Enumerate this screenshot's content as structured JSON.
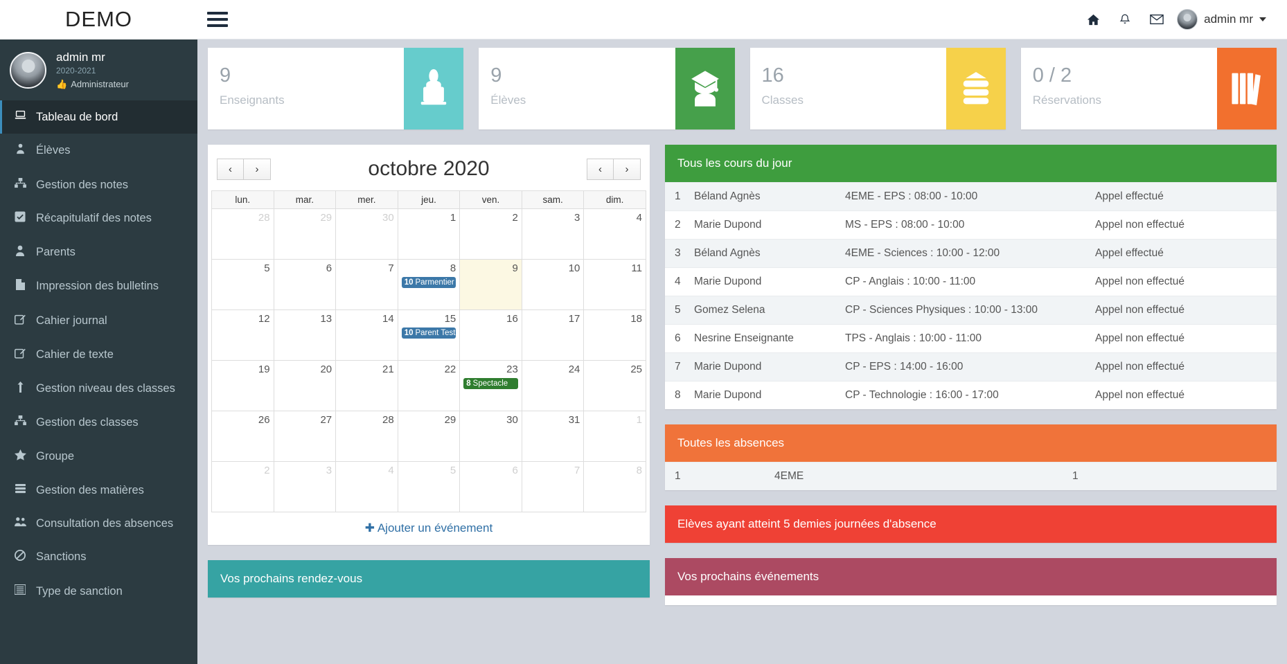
{
  "brand": {
    "title": "DEMO"
  },
  "topbar": {
    "icons": [
      {
        "name": "home-icon",
        "glyph": "⌂"
      },
      {
        "name": "bell-icon",
        "glyph": "△"
      },
      {
        "name": "envelope-icon",
        "glyph": "✉"
      }
    ],
    "user": "admin mr"
  },
  "sidebar": {
    "user": {
      "name": "admin mr",
      "year": "2020-2021",
      "role": "Administrateur",
      "role_icon": "thumbs-up-icon"
    },
    "items": [
      {
        "label": "Tableau de bord",
        "icon": "laptop-icon",
        "glyph": "⬜",
        "active": true
      },
      {
        "label": "Élèves",
        "icon": "user-tie-icon",
        "glyph": "♟",
        "active": false
      },
      {
        "label": "Gestion des notes",
        "icon": "sitemap-icon",
        "glyph": "⚘",
        "active": false
      },
      {
        "label": "Récapitulatif des notes",
        "icon": "check-square-icon",
        "glyph": "☑",
        "active": false
      },
      {
        "label": "Parents",
        "icon": "user-icon",
        "glyph": "♟",
        "active": false
      },
      {
        "label": "Impression des bulletins",
        "icon": "file-icon",
        "glyph": "▯",
        "active": false
      },
      {
        "label": "Cahier journal",
        "icon": "edit-icon",
        "glyph": "✎",
        "active": false
      },
      {
        "label": "Cahier de texte",
        "icon": "edit-icon",
        "glyph": "✎",
        "active": false
      },
      {
        "label": "Gestion niveau des classes",
        "icon": "level-up-icon",
        "glyph": "⤴",
        "active": false
      },
      {
        "label": "Gestion des classes",
        "icon": "sitemap-icon",
        "glyph": "⚙",
        "active": false
      },
      {
        "label": "Groupe",
        "icon": "star-icon",
        "glyph": "★",
        "active": false
      },
      {
        "label": "Gestion des matières",
        "icon": "books-icon",
        "glyph": "☰",
        "active": false
      },
      {
        "label": "Consultation des absences",
        "icon": "users-icon",
        "glyph": "♟",
        "active": false
      },
      {
        "label": "Sanctions",
        "icon": "ban-icon",
        "glyph": "⊘",
        "active": false
      },
      {
        "label": "Type de sanction",
        "icon": "list-icon",
        "glyph": "☰",
        "active": false
      }
    ]
  },
  "stats": [
    {
      "value": "9",
      "label": "Enseignants",
      "color": "#66cccc",
      "icon": "teacher-icon"
    },
    {
      "value": "9",
      "label": "Élèves",
      "color": "#46a04b",
      "icon": "graduate-icon"
    },
    {
      "value": "16",
      "label": "Classes",
      "color": "#f6d14a",
      "icon": "books-stack-icon"
    },
    {
      "value": "0 / 2",
      "label": "Réservations",
      "color": "#f2702e",
      "icon": "library-icon"
    }
  ],
  "calendar": {
    "title": "octobre 2020",
    "nav": {
      "prev": "‹",
      "next": "›"
    },
    "weekdays": [
      "lun.",
      "mar.",
      "mer.",
      "jeu.",
      "ven.",
      "sam.",
      "dim."
    ],
    "add_event_label": "Ajouter un événement",
    "add_event_icon": "plus-icon",
    "weeks": [
      [
        {
          "d": "28",
          "other": true
        },
        {
          "d": "29",
          "other": true
        },
        {
          "d": "30",
          "other": true
        },
        {
          "d": "1"
        },
        {
          "d": "2"
        },
        {
          "d": "3"
        },
        {
          "d": "4"
        }
      ],
      [
        {
          "d": "5"
        },
        {
          "d": "6"
        },
        {
          "d": "7"
        },
        {
          "d": "8",
          "event": {
            "count": "10",
            "title": "Parmentier",
            "color": "blue"
          }
        },
        {
          "d": "9",
          "today": true
        },
        {
          "d": "10"
        },
        {
          "d": "11"
        }
      ],
      [
        {
          "d": "12"
        },
        {
          "d": "13"
        },
        {
          "d": "14"
        },
        {
          "d": "15",
          "event": {
            "count": "10",
            "title": "Parent Test",
            "color": "blue"
          }
        },
        {
          "d": "16"
        },
        {
          "d": "17"
        },
        {
          "d": "18"
        }
      ],
      [
        {
          "d": "19"
        },
        {
          "d": "20"
        },
        {
          "d": "21"
        },
        {
          "d": "22"
        },
        {
          "d": "23",
          "event": {
            "count": "8",
            "title": "Spectacle",
            "color": "green"
          }
        },
        {
          "d": "24"
        },
        {
          "d": "25"
        }
      ],
      [
        {
          "d": "26"
        },
        {
          "d": "27"
        },
        {
          "d": "28"
        },
        {
          "d": "29"
        },
        {
          "d": "30"
        },
        {
          "d": "31"
        },
        {
          "d": "1",
          "other": true
        }
      ],
      [
        {
          "d": "2",
          "other": true
        },
        {
          "d": "3",
          "other": true
        },
        {
          "d": "4",
          "other": true
        },
        {
          "d": "5",
          "other": true
        },
        {
          "d": "6",
          "other": true
        },
        {
          "d": "7",
          "other": true
        },
        {
          "d": "8",
          "other": true
        }
      ]
    ]
  },
  "appointments": {
    "title": "Vos prochains rendez-vous"
  },
  "courses": {
    "title": "Tous les cours du jour",
    "rows": [
      {
        "idx": "1",
        "teacher": "Béland Agnès",
        "course": "4EME - EPS : 08:00 - 10:00",
        "status": "Appel effectué",
        "status_type": "done"
      },
      {
        "idx": "2",
        "teacher": "Marie Dupond",
        "course": "MS - EPS : 08:00 - 10:00",
        "status": "Appel non effectué",
        "status_type": "pending"
      },
      {
        "idx": "3",
        "teacher": "Béland Agnès",
        "course": "4EME - Sciences : 10:00 - 12:00",
        "status": "Appel effectué",
        "status_type": "done"
      },
      {
        "idx": "4",
        "teacher": "Marie Dupond",
        "course": "CP - Anglais : 10:00 - 11:00",
        "status": "Appel non effectué",
        "status_type": "pending"
      },
      {
        "idx": "5",
        "teacher": "Gomez Selena",
        "course": "CP - Sciences Physiques : 10:00 - 13:00",
        "status": "Appel non effectué",
        "status_type": "pending"
      },
      {
        "idx": "6",
        "teacher": "Nesrine Enseignante",
        "course": "TPS - Anglais : 10:00 - 11:00",
        "status": "Appel non effectué",
        "status_type": "pending"
      },
      {
        "idx": "7",
        "teacher": "Marie Dupond",
        "course": "CP - EPS : 14:00 - 16:00",
        "status": "Appel non effectué",
        "status_type": "pending"
      },
      {
        "idx": "8",
        "teacher": "Marie Dupond",
        "course": "CP - Technologie : 16:00 - 17:00",
        "status": "Appel non effectué",
        "status_type": "pending"
      }
    ]
  },
  "absences": {
    "title": "Toutes les absences",
    "rows": [
      {
        "idx": "1",
        "classe": "4EME",
        "count": "1"
      }
    ]
  },
  "threshold": {
    "title": "Elèves ayant atteint 5 demies journées d'absence"
  },
  "events": {
    "title": "Vos prochains événements"
  }
}
